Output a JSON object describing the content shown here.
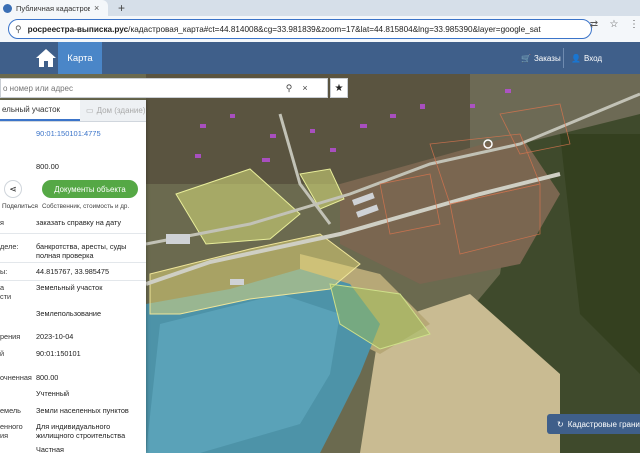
{
  "browser": {
    "tab_title": "Публичная кадастровая ка",
    "url_domain": "росреестра-выписка.рус",
    "url_path": "/кадастровая_карта#ct=44.814008&cg=33.981839&zoom=17&lat=44.815804&lng=33.985390&layer=google_sat"
  },
  "header": {
    "map_tab": "Карта",
    "orders_label": "Заказы",
    "login_label": "Вход"
  },
  "search": {
    "placeholder": "о номер или адрес"
  },
  "panel": {
    "tab_parcel": "ельный участок",
    "tab_building": "Дом (здание)",
    "cad_number": "90:01:150101:4775",
    "area_top": "800.00",
    "share_label": "Поделиться",
    "doc_button": "Документы объекта",
    "doc_sub": "Собственник, стоимость и др.",
    "rows": [
      {
        "k": "я",
        "v": "заказать справку на дату",
        "link": true
      },
      {
        "k": "деле:",
        "v": "банкротства, аресты, суды",
        "v2": "полная проверка"
      },
      {
        "k": "ы:",
        "v": "44.815767, 33.985475"
      },
      {
        "k": "а",
        "k2": "сти",
        "v": "Земельный участок"
      },
      {
        "k": "",
        "v": "Землепользование"
      },
      {
        "k": "рения",
        "v": "2023-10-04"
      },
      {
        "k": "й",
        "v": "90:01:150101"
      },
      {
        "k": "очненная",
        "v": "800.00"
      },
      {
        "k": "",
        "v": "Учтенный"
      },
      {
        "k": "емель",
        "v": "Земли населенных пунктов"
      },
      {
        "k": "енного",
        "k2": "ия",
        "v": "Для индивидуального",
        "v2": "жилищного строительства"
      },
      {
        "k": "",
        "v": "Частная"
      }
    ]
  },
  "map": {
    "cadastral_button": "Кадастровые границ"
  }
}
